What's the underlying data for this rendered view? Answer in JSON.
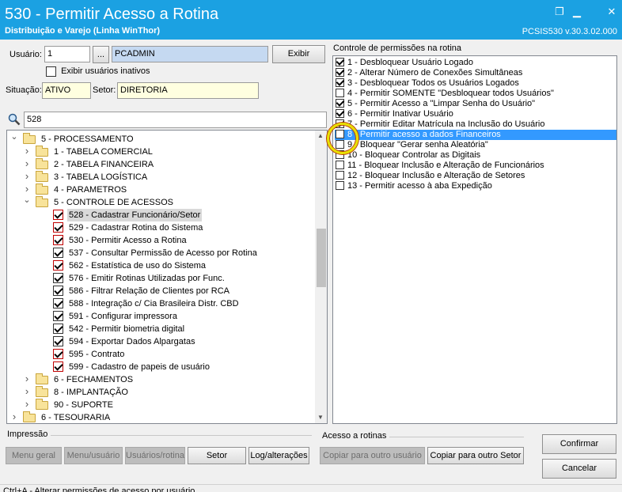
{
  "window": {
    "title": "530 - Permitir Acesso a Rotina",
    "subtitle": "Distribuição e Varejo (Linha WinThor)",
    "version": "PCSIS530   v.30.3.02.000"
  },
  "user": {
    "label": "Usuário:",
    "code": "1",
    "lookup_btn": "...",
    "name": "PCADMIN",
    "exibir_btn": "Exibir",
    "inactive_label": "Exibir usuários inativos",
    "situacao_label": "Situação:",
    "situacao": "ATIVO",
    "setor_label": "Setor:",
    "setor": "DIRETORIA"
  },
  "search": {
    "value": "528"
  },
  "tree": [
    {
      "label": "5 - PROCESSAMENTO",
      "level": 0,
      "type": "folder",
      "expanded": true
    },
    {
      "label": "1 - TABELA COMERCIAL",
      "level": 1,
      "type": "folder"
    },
    {
      "label": "2 - TABELA FINANCEIRA",
      "level": 1,
      "type": "folder"
    },
    {
      "label": "3 - TABELA LOGÍSTICA",
      "level": 1,
      "type": "folder"
    },
    {
      "label": "4 - PARAMETROS",
      "level": 1,
      "type": "folder"
    },
    {
      "label": "5 - CONTROLE DE ACESSOS",
      "level": 1,
      "type": "folder",
      "expanded": true
    },
    {
      "label": "528 - Cadastrar Funcionário/Setor",
      "level": 2,
      "type": "item",
      "red": true,
      "selected": true
    },
    {
      "label": "529 - Cadastrar Rotina do Sistema",
      "level": 2,
      "type": "item",
      "red": true
    },
    {
      "label": "530 - Permitir Acesso a Rotina",
      "level": 2,
      "type": "item",
      "red": true
    },
    {
      "label": "537 - Consultar Permissão de Acesso por Rotina",
      "level": 2,
      "type": "item"
    },
    {
      "label": "562 - Estatística de uso do Sistema",
      "level": 2,
      "type": "item",
      "red": true
    },
    {
      "label": "576 - Emitir Rotinas Utilizadas por Func.",
      "level": 2,
      "type": "item"
    },
    {
      "label": "586 - Filtrar Relação de Clientes por RCA",
      "level": 2,
      "type": "item"
    },
    {
      "label": "588 - Integração c/ Cia Brasileira Distr. CBD",
      "level": 2,
      "type": "item"
    },
    {
      "label": "591 - Configurar impressora",
      "level": 2,
      "type": "item"
    },
    {
      "label": "542 - Permitir biometria digital",
      "level": 2,
      "type": "item"
    },
    {
      "label": "594 - Exportar Dados Alpargatas",
      "level": 2,
      "type": "item"
    },
    {
      "label": "595 - Contrato",
      "level": 2,
      "type": "item",
      "red": true
    },
    {
      "label": "599 - Cadastro de papeis de usuário",
      "level": 2,
      "type": "item",
      "red": true
    },
    {
      "label": "6 - FECHAMENTOS",
      "level": 1,
      "type": "folder"
    },
    {
      "label": "8 - IMPLANTAÇÃO",
      "level": 1,
      "type": "folder"
    },
    {
      "label": "90 - SUPORTE",
      "level": 1,
      "type": "folder"
    },
    {
      "label": "6 - TESOURARIA",
      "level": 0,
      "type": "folder"
    }
  ],
  "permissions": {
    "title": "Controle de permissões na rotina",
    "items": [
      {
        "label": "1 - Desbloquear Usuário Logado",
        "checked": true
      },
      {
        "label": "2 - Alterar Número de Conexões Simultâneas",
        "checked": true
      },
      {
        "label": "3 - Desbloquear Todos os Usuários Logados",
        "checked": true
      },
      {
        "label": "4 - Permitir SOMENTE \"Desbloquear todos Usuários\"",
        "checked": false
      },
      {
        "label": "5 - Permitir Acesso a \"Limpar Senha do Usuário\"",
        "checked": true
      },
      {
        "label": "6 - Permitir Inativar Usuário",
        "checked": true
      },
      {
        "label": "7 - Permitir Editar Matrícula na Inclusão do Usuário",
        "checked": true
      },
      {
        "label": "8 - Permitir acesso a dados Financeiros",
        "checked": false,
        "selected": true
      },
      {
        "label": "9 - Bloquear \"Gerar senha Aleatória\"",
        "checked": false
      },
      {
        "label": "10 - Bloquear Controlar as Digitais",
        "checked": false
      },
      {
        "label": "11 - Bloquear Inclusão e Alteração de Funcionários",
        "checked": false
      },
      {
        "label": "12 - Bloquear Inclusão e Alteração de Setores",
        "checked": false
      },
      {
        "label": "13 - Permitir acesso à aba Expedição",
        "checked": false
      }
    ]
  },
  "impressao": {
    "title": "Impressão",
    "menu_geral": "Menu geral",
    "menu_usuario": "Menu/usuário",
    "usuarios_rotina": "Usuários/rotina",
    "setor": "Setor",
    "log": "Log/alterações"
  },
  "acesso": {
    "title": "Acesso a rotinas",
    "copiar_usuario": "Copiar para outro usuário",
    "copiar_setor": "Copiar para outro Setor"
  },
  "actions": {
    "confirmar": "Confirmar",
    "cancelar": "Cancelar"
  },
  "status": {
    "text": "Ctrl+A - Alterar permissões de acesso por usuário"
  },
  "colors": {
    "titlebar": "#1ba1e2",
    "highlight": "#3399ff",
    "marker": "#e8e000"
  }
}
